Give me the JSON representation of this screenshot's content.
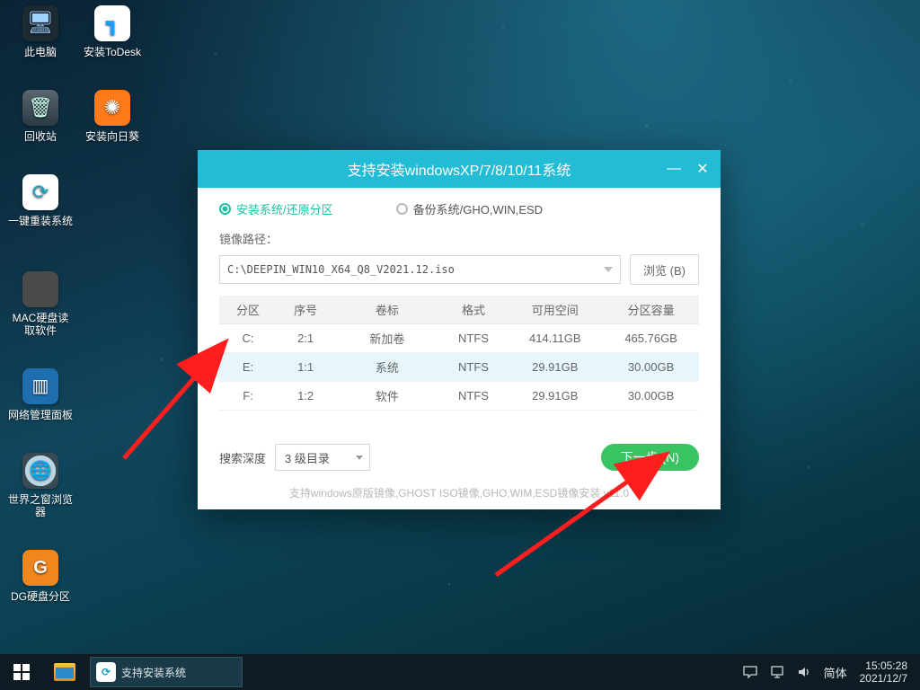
{
  "desktop_icons": [
    {
      "label": "此电脑",
      "bg": "#1b2a33",
      "glyph": "🖥"
    },
    {
      "label": "安装ToDesk",
      "bg": "#ffffff",
      "glyph": "T"
    },
    {
      "label": "回收站",
      "bg": "#2a3a44",
      "glyph": "🗑"
    },
    {
      "label": "安装向日葵",
      "bg": "#ff7a1a",
      "glyph": "✳"
    },
    {
      "label": "一键重装系统",
      "bg": "#ffffff",
      "glyph": "↻"
    },
    {
      "label": "MAC硬盘读取软件",
      "bg": "#4a4a4a",
      "glyph": ""
    },
    {
      "label": "网络管理面板",
      "bg": "#1f6fb0",
      "glyph": "📊"
    },
    {
      "label": "世界之窗浏览器",
      "bg": "#3a4a55",
      "glyph": "🌐"
    },
    {
      "label": "DG硬盘分区",
      "bg": "#f0861e",
      "glyph": "G"
    }
  ],
  "dialog": {
    "title": "支持安装windowsXP/7/8/10/11系统",
    "mode_install": "安装系统/还原分区",
    "mode_backup": "备份系统/GHO,WIN,ESD",
    "path_label": "镜像路径：",
    "path_value": "C:\\DEEPIN_WIN10_X64_Q8_V2021.12.iso",
    "browse": "浏览 (B)",
    "table": {
      "headers": [
        "分区",
        "序号",
        "卷标",
        "格式",
        "可用空间",
        "分区容量"
      ],
      "rows": [
        {
          "drive": "C:",
          "idx": "2:1",
          "label": "新加卷",
          "fs": "NTFS",
          "free": "414.11GB",
          "cap": "465.76GB",
          "selected": false
        },
        {
          "drive": "E:",
          "idx": "1:1",
          "label": "系统",
          "fs": "NTFS",
          "free": "29.91GB",
          "cap": "30.00GB",
          "selected": true
        },
        {
          "drive": "F:",
          "idx": "1:2",
          "label": "软件",
          "fs": "NTFS",
          "free": "29.91GB",
          "cap": "30.00GB",
          "selected": false
        }
      ]
    },
    "depth_label": "搜索深度",
    "depth_value": "3 级目录",
    "next": "下一步 (N)",
    "footnote": "支持windows原版镜像,GHOST ISO镜像,GHO,WIM,ESD镜像安装  v11.0"
  },
  "taskbar": {
    "running": "支持安装系统",
    "ime": "简体",
    "time": "15:05:28",
    "date": "2021/12/7"
  }
}
